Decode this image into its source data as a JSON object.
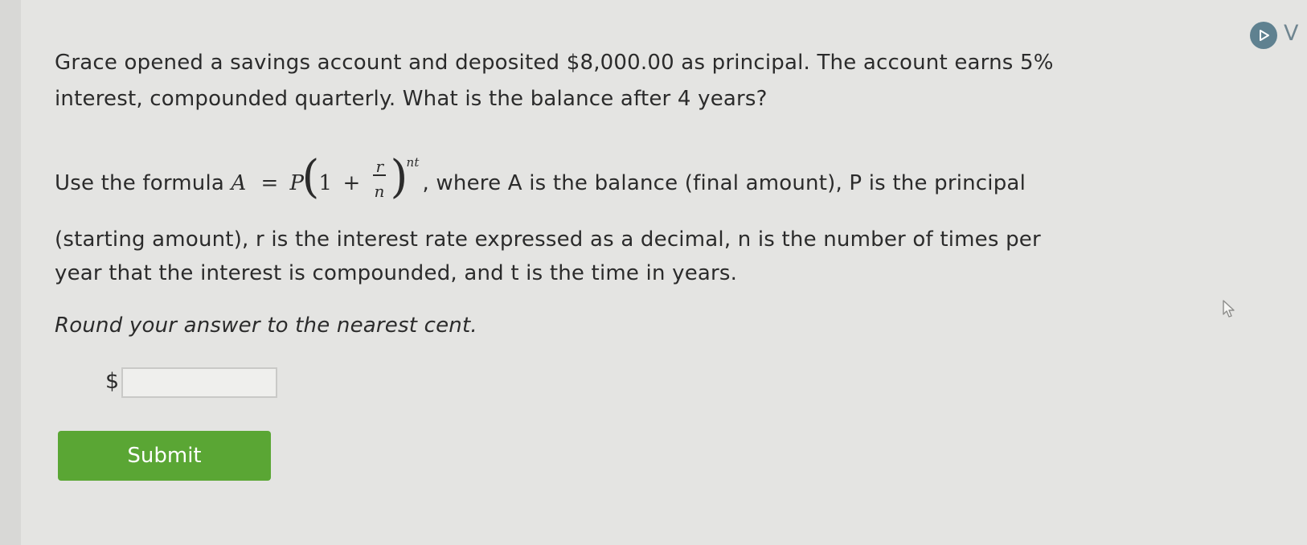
{
  "badge": {
    "icon": "play-icon",
    "letter": "V",
    "color": "#5f8190"
  },
  "question": {
    "line1": "Grace opened a savings account and deposited $8,000.00 as principal. The account earns 5%",
    "line2": "interest, compounded quarterly. What is the balance after 4 years?"
  },
  "formula_text": {
    "prefix": "Use the formula ",
    "suffix": ", where A is the balance (final amount), P is the principal",
    "line2": "(starting amount), r is the interest rate expressed as a decimal, n is the number of times per",
    "line3": "year that the interest is compounded, and t is the time in years."
  },
  "formula": {
    "lhs": "A",
    "eq": "=",
    "p": "P",
    "lparen": "(",
    "one": "1",
    "plus": "+",
    "num": "r",
    "den": "n",
    "rparen": ")",
    "exponent": "nt"
  },
  "instruction": "Round your answer to the nearest cent.",
  "answer": {
    "currency": "$",
    "value": "",
    "placeholder": ""
  },
  "submit": {
    "label": "Submit",
    "color": "#5aa634"
  },
  "cursor": {
    "icon": "mouse-pointer-icon"
  }
}
